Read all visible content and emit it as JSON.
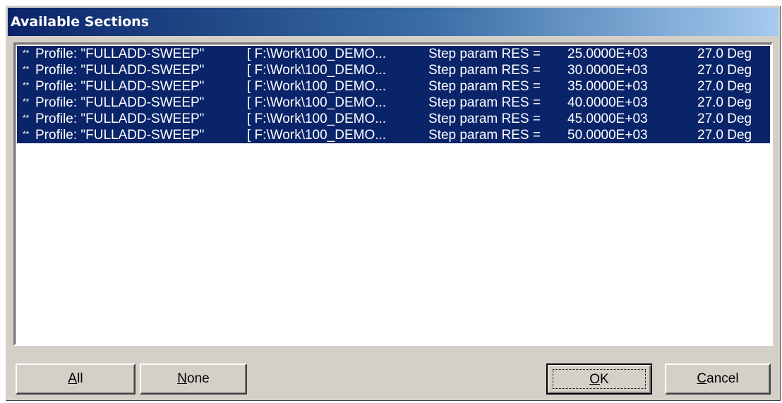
{
  "dialog": {
    "title": "Available Sections"
  },
  "sections": [
    {
      "prefix": "**",
      "profile": "Profile: \"FULLADD-SWEEP\"",
      "path": "[ F:\\Work\\100_DEMO...",
      "step": "Step param RES =",
      "value": "25.0000E+03",
      "angle": "27.0 Deg"
    },
    {
      "prefix": "**",
      "profile": "Profile: \"FULLADD-SWEEP\"",
      "path": "[ F:\\Work\\100_DEMO...",
      "step": "Step param RES =",
      "value": "30.0000E+03",
      "angle": "27.0 Deg"
    },
    {
      "prefix": "**",
      "profile": "Profile: \"FULLADD-SWEEP\"",
      "path": "[ F:\\Work\\100_DEMO...",
      "step": "Step param RES =",
      "value": "35.0000E+03",
      "angle": "27.0 Deg"
    },
    {
      "prefix": "**",
      "profile": "Profile: \"FULLADD-SWEEP\"",
      "path": "[ F:\\Work\\100_DEMO...",
      "step": "Step param RES =",
      "value": "40.0000E+03",
      "angle": "27.0 Deg"
    },
    {
      "prefix": "**",
      "profile": "Profile: \"FULLADD-SWEEP\"",
      "path": "[ F:\\Work\\100_DEMO...",
      "step": "Step param RES =",
      "value": "45.0000E+03",
      "angle": "27.0 Deg"
    },
    {
      "prefix": "**",
      "profile": "Profile: \"FULLADD-SWEEP\"",
      "path": "[ F:\\Work\\100_DEMO...",
      "step": "Step param RES =",
      "value": "50.0000E+03",
      "angle": "27.0 Deg"
    }
  ],
  "buttons": {
    "all": {
      "first": "A",
      "rest": "ll"
    },
    "none": {
      "first": "N",
      "rest": "one"
    },
    "ok": {
      "first": "O",
      "rest": "K"
    },
    "cancel": {
      "first": "C",
      "rest": "ancel"
    }
  },
  "colors": {
    "selection": "#0a246a",
    "dialog_face": "#d4d0c8",
    "title_gradient_start": "#0a246a",
    "title_gradient_end": "#a6caf0"
  }
}
